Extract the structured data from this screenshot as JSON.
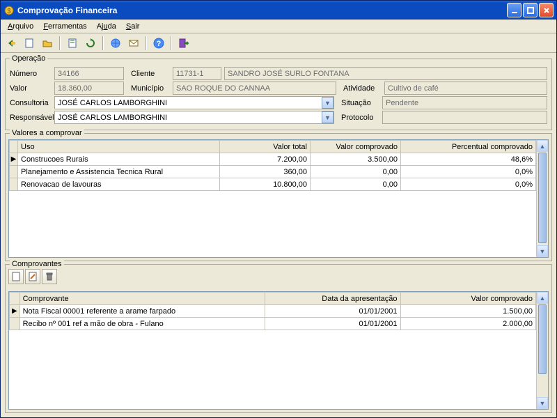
{
  "window": {
    "title": "Comprovação Financeira"
  },
  "menu": {
    "arquivo": "Arquivo",
    "ferramentas": "Ferramentas",
    "ajuda": "Ajuda",
    "sair": "Sair"
  },
  "operacao": {
    "legend": "Operação",
    "numero_label": "Número",
    "numero": "34166",
    "cliente_label": "Cliente",
    "cliente_cod": "11731-1",
    "cliente_nome": "SANDRO JOSÉ SURLO FONTANA",
    "valor_label": "Valor",
    "valor": "18.360,00",
    "municipio_label": "Município",
    "municipio": "SAO ROQUE DO CANNAA",
    "atividade_label": "Atividade",
    "atividade": "Cultivo de café",
    "consultoria_label": "Consultoria",
    "consultoria": "JOSÉ CARLOS LAMBORGHINI",
    "situacao_label": "Situação",
    "situacao": "Pendente",
    "responsavel_label": "Responsável",
    "responsavel": "JOSÉ CARLOS LAMBORGHINI",
    "protocolo_label": "Protocolo",
    "protocolo": ""
  },
  "valores": {
    "legend": "Valores a comprovar",
    "cols": {
      "uso": "Uso",
      "total": "Valor total",
      "comprovado": "Valor comprovado",
      "pct": "Percentual comprovado"
    },
    "rows": [
      {
        "uso": "Construcoes Rurais",
        "total": "7.200,00",
        "comprovado": "3.500,00",
        "pct": "48,6%",
        "sel": true
      },
      {
        "uso": "Planejamento e Assistencia Tecnica Rural",
        "total": "360,00",
        "comprovado": "0,00",
        "pct": "0,0%",
        "sel": false
      },
      {
        "uso": "Renovacao de lavouras",
        "total": "10.800,00",
        "comprovado": "0,00",
        "pct": "0,0%",
        "sel": false
      }
    ]
  },
  "comprovantes": {
    "legend": "Comprovantes",
    "cols": {
      "comp": "Comprovante",
      "data": "Data da apresentação",
      "valor": "Valor comprovado"
    },
    "rows": [
      {
        "comp": "Nota Fiscal 00001 referente a arame farpado",
        "data": "01/01/2001",
        "valor": "1.500,00",
        "sel": true
      },
      {
        "comp": "Recibo nº 001 ref a mão de obra - Fulano",
        "data": "01/01/2001",
        "valor": "2.000,00",
        "sel": false
      }
    ]
  }
}
